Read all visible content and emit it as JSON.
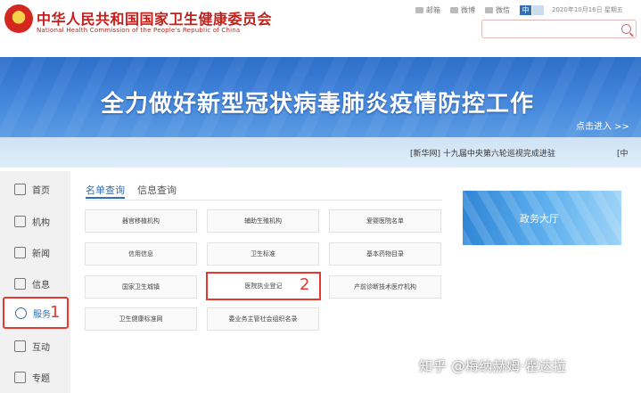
{
  "header": {
    "title_cn": "中华人民共和国国家卫生健康委员会",
    "title_en": "National Health Commission of the People's Republic of China",
    "top_links": [
      {
        "label": "邮箱",
        "icon": "mail-icon"
      },
      {
        "label": "微博",
        "icon": "weibo-icon"
      },
      {
        "label": "微信",
        "icon": "wechat-icon"
      }
    ],
    "lang_zh": "中",
    "lang_en": "",
    "date": "2020年10月16日 星期五",
    "search_placeholder": ""
  },
  "banner": {
    "title": "全力做好新型冠状病毒肺炎疫情防控工作",
    "enter_label": "点击进入 >>"
  },
  "ticker": {
    "text": "[新华网] 十九届中央第六轮巡视完成进驻",
    "end_text": "[中"
  },
  "sidebar": {
    "items": [
      {
        "label": "首页",
        "icon": "home-icon"
      },
      {
        "label": "机构",
        "icon": "organization-icon"
      },
      {
        "label": "新闻",
        "icon": "news-icon"
      },
      {
        "label": "信息",
        "icon": "info-icon"
      },
      {
        "label": "服务",
        "icon": "heart-icon"
      },
      {
        "label": "互动",
        "icon": "chat-icon"
      },
      {
        "label": "专题",
        "icon": "tag-icon"
      }
    ],
    "annotation": "1"
  },
  "main": {
    "tabs": [
      "名单查询",
      "信息查询"
    ],
    "buttons": [
      "器官移植机构",
      "辅助生殖机构",
      "爱婴医院名单",
      "信用信息",
      "卫生标准",
      "基本药物目录",
      "国家卫生城镇",
      "医院执业登记",
      "产前诊断技术医疗机构",
      "卫生健康标准网",
      "委业务主管社会组织名录"
    ],
    "annotation": "2"
  },
  "service_hall": {
    "label": "政务大厅"
  },
  "watermark": "知乎 @梅纳赫姆·霍达拉",
  "colors": {
    "brand_red": "#c41e1a",
    "accent_blue": "#2f6fb8",
    "annotation_red": "#e33a2e"
  }
}
